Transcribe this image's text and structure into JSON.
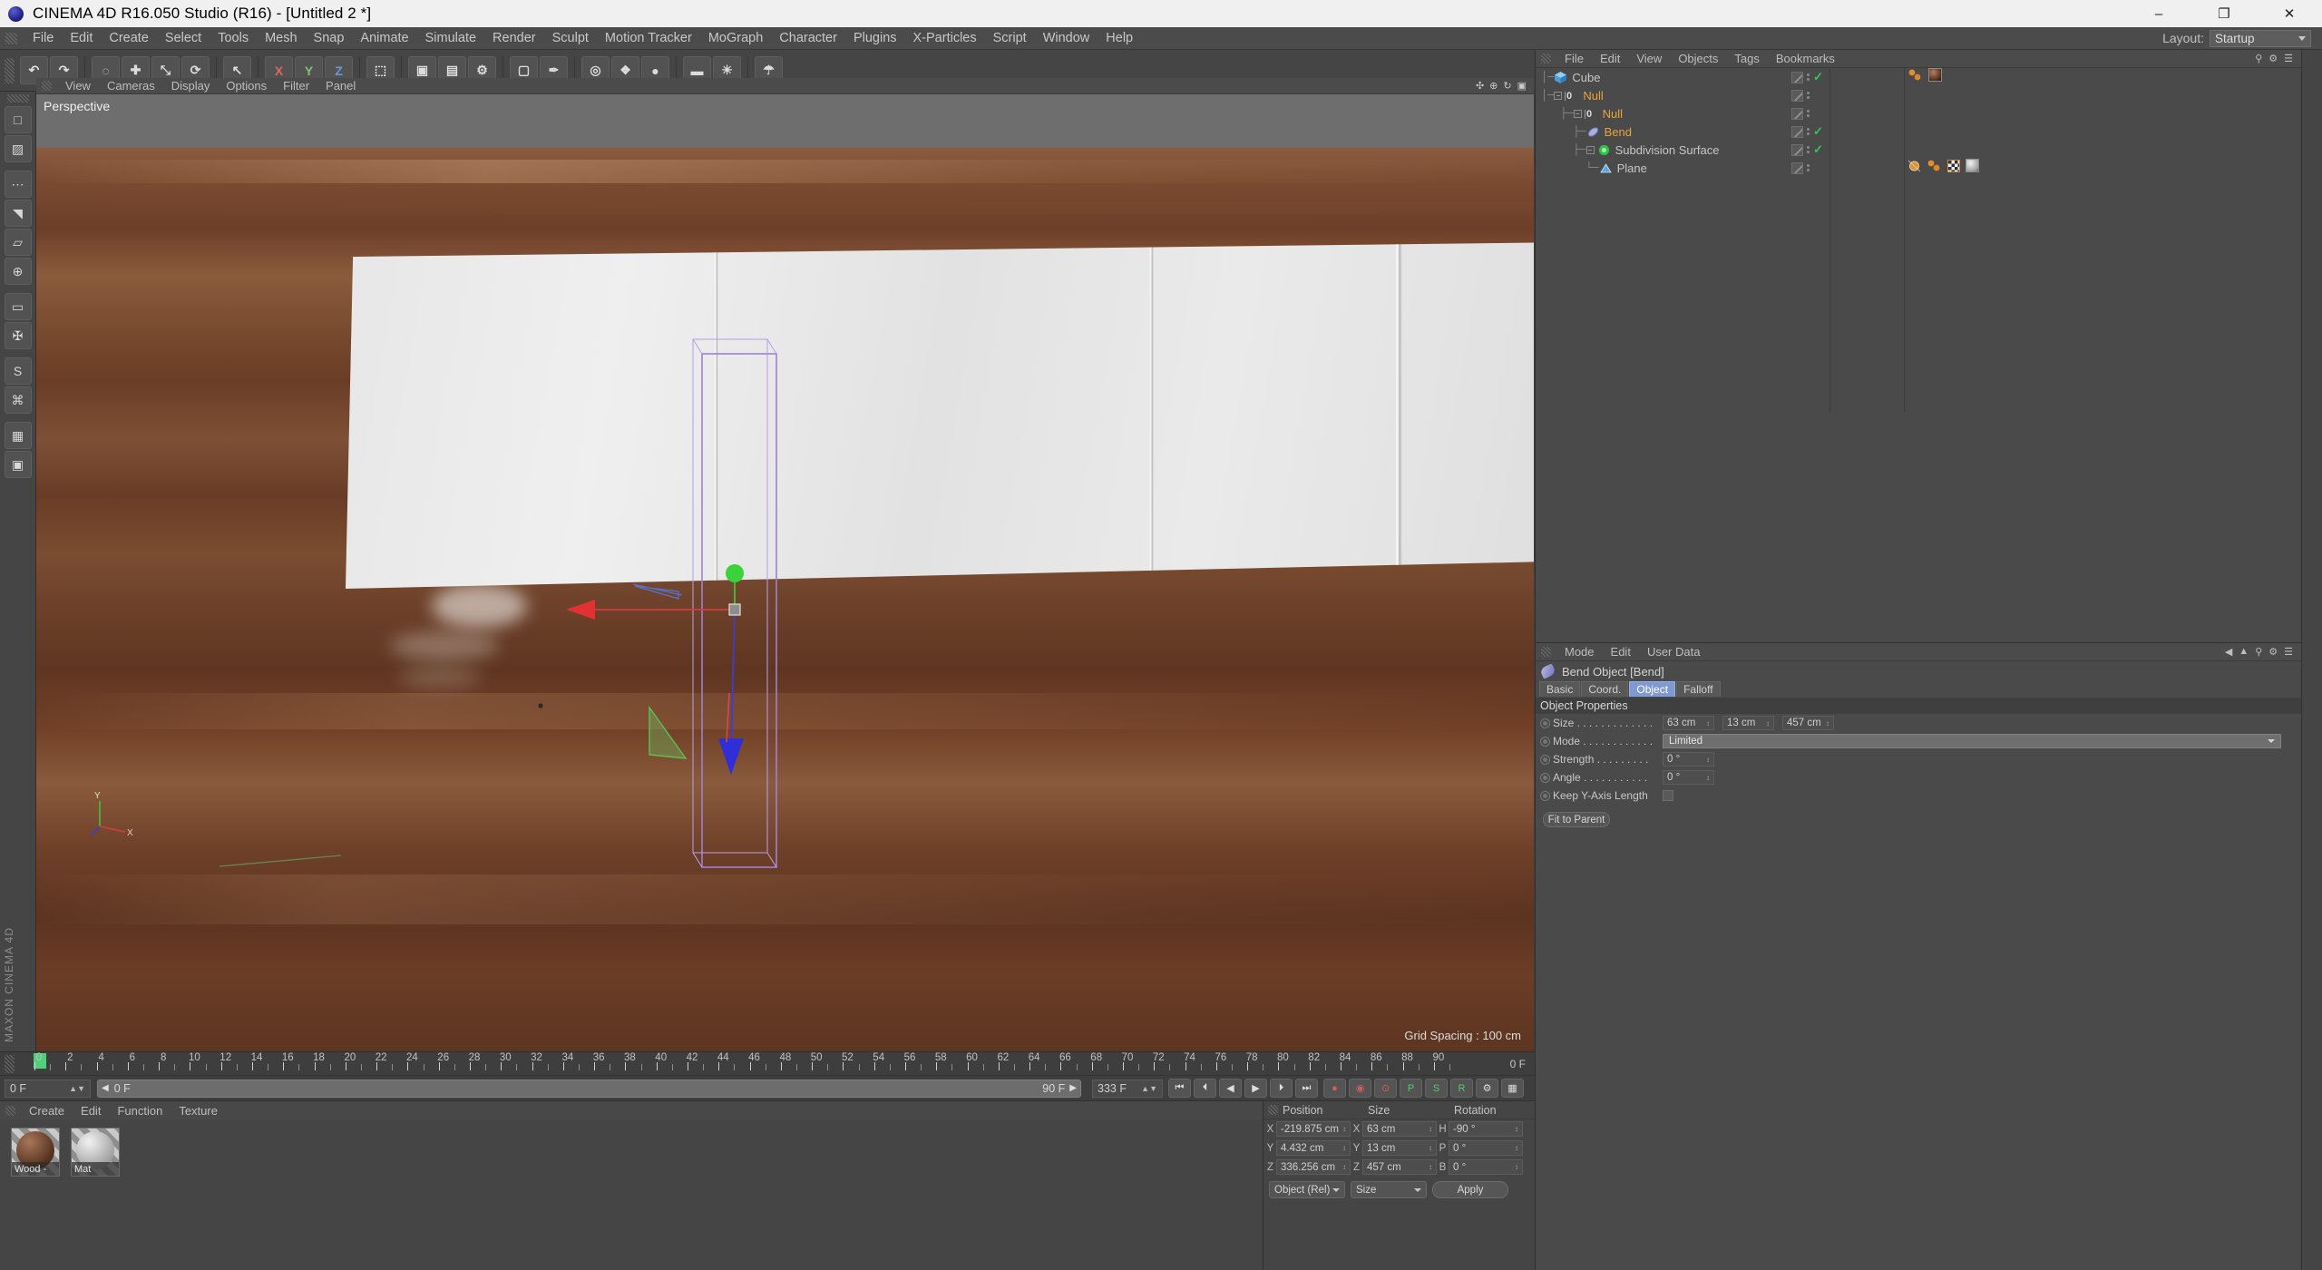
{
  "window": {
    "title": "CINEMA 4D R16.050 Studio (R16) - [Untitled 2 *]",
    "minimize": "–",
    "maximize": "❐",
    "close": "✕"
  },
  "menubar": {
    "items": [
      "File",
      "Edit",
      "Create",
      "Select",
      "Tools",
      "Mesh",
      "Snap",
      "Animate",
      "Simulate",
      "Render",
      "Sculpt",
      "Motion Tracker",
      "MoGraph",
      "Character",
      "Plugins",
      "X-Particles",
      "Script",
      "Window",
      "Help"
    ],
    "layout_label": "Layout:",
    "layout_value": "Startup"
  },
  "toolbar": {
    "groups": [
      [
        {
          "name": "undo-button",
          "glyph": "↶"
        },
        {
          "name": "redo-button",
          "glyph": "↷"
        }
      ],
      [
        {
          "name": "live-selection-tool",
          "glyph": "◌"
        },
        {
          "name": "move-tool",
          "glyph": "✚"
        },
        {
          "name": "scale-tool",
          "glyph": "⤡"
        },
        {
          "name": "rotate-tool",
          "glyph": "⟳"
        }
      ],
      [
        {
          "name": "cursor-tool",
          "glyph": "↖"
        }
      ],
      [
        {
          "name": "x-axis-lock",
          "glyph": "X",
          "cls": "x"
        },
        {
          "name": "y-axis-lock",
          "glyph": "Y",
          "cls": "y"
        },
        {
          "name": "z-axis-lock",
          "glyph": "Z",
          "cls": "z"
        }
      ],
      [
        {
          "name": "world-object-coords",
          "glyph": "⬚"
        }
      ],
      [
        {
          "name": "render-view-button",
          "glyph": "▣"
        },
        {
          "name": "render-region-button",
          "glyph": "▤"
        },
        {
          "name": "render-settings-button",
          "glyph": "⚙"
        }
      ],
      [
        {
          "name": "primitive-cube-button",
          "glyph": "▢"
        },
        {
          "name": "spline-pen-button",
          "glyph": "✒"
        }
      ],
      [
        {
          "name": "nurbs-button",
          "glyph": "◎"
        },
        {
          "name": "array-button",
          "glyph": "❖"
        },
        {
          "name": "scene-button",
          "glyph": "●"
        }
      ],
      [
        {
          "name": "camera-button",
          "glyph": "▬"
        },
        {
          "name": "light-button",
          "glyph": "☀"
        }
      ],
      [
        {
          "name": "deformer-button",
          "glyph": "☂"
        }
      ]
    ]
  },
  "left_palette": {
    "buttons": [
      {
        "name": "model-mode-button",
        "glyph": "□"
      },
      {
        "name": "texture-mode-button",
        "glyph": "▨"
      },
      {
        "name": "points-mode-button",
        "glyph": "⋯"
      },
      {
        "name": "edges-mode-button",
        "glyph": "◥"
      },
      {
        "name": "polygons-mode-button",
        "glyph": "▱"
      },
      {
        "name": "axis-mode-button",
        "glyph": "⊕"
      },
      {
        "name": "workplane-button",
        "glyph": "▭"
      },
      {
        "name": "enable-axis-button",
        "glyph": "✠"
      },
      {
        "name": "snap-toggle-button",
        "glyph": "S"
      },
      {
        "name": "magnet-tool-button",
        "glyph": "⌘"
      },
      {
        "name": "viewport-solo-button",
        "glyph": "▦"
      },
      {
        "name": "layout-grid-button",
        "glyph": "▣"
      }
    ],
    "brand": "MAXON CINEMA 4D"
  },
  "viewport": {
    "header_menu": [
      "View",
      "Cameras",
      "Display",
      "Options",
      "Filter",
      "Panel"
    ],
    "camera_label": "Perspective",
    "grid_spacing": "Grid Spacing : 100 cm",
    "axis_y_label": "Y",
    "axis_x_label": "X"
  },
  "timeline": {
    "ticks": [
      0,
      2,
      4,
      6,
      8,
      10,
      12,
      14,
      16,
      18,
      20,
      22,
      24,
      26,
      28,
      30,
      32,
      34,
      36,
      38,
      40,
      42,
      44,
      46,
      48,
      50,
      52,
      54,
      56,
      58,
      60,
      62,
      64,
      66,
      68,
      70,
      72,
      74,
      76,
      78,
      80,
      82,
      84,
      86,
      88,
      90
    ],
    "current_frame_right": "0 F",
    "frame_field": "0 F",
    "range_start": "0 F",
    "range_end": "90 F",
    "end_frame_field": "333 F",
    "transport": [
      {
        "name": "goto-start-button",
        "glyph": "⏮"
      },
      {
        "name": "step-back-button",
        "glyph": "⏴"
      },
      {
        "name": "play-back-button",
        "glyph": "◀"
      },
      {
        "name": "play-forward-button",
        "glyph": "▶"
      },
      {
        "name": "step-forward-button",
        "glyph": "⏵"
      },
      {
        "name": "goto-end-button",
        "glyph": "⏭"
      }
    ],
    "record_buttons": [
      {
        "name": "record-keyframe-button",
        "glyph": "●",
        "cls": "red"
      },
      {
        "name": "autokey-button",
        "glyph": "◉",
        "cls": "red"
      },
      {
        "name": "keyframe-selection-button",
        "glyph": "⊙",
        "cls": "red"
      },
      {
        "name": "position-key-button",
        "glyph": "P",
        "cls": "green"
      },
      {
        "name": "scale-key-button",
        "glyph": "S",
        "cls": "green"
      },
      {
        "name": "rotation-key-button",
        "glyph": "R",
        "cls": "green"
      },
      {
        "name": "param-key-button",
        "glyph": "⚙",
        "cls": ""
      },
      {
        "name": "pla-key-button",
        "glyph": "▦",
        "cls": ""
      }
    ]
  },
  "material_manager": {
    "menu": [
      "Create",
      "Edit",
      "Function",
      "Texture"
    ],
    "materials": [
      {
        "name": "Wood -",
        "color_top": "#a8765a",
        "color_bottom": "#4a2a17"
      },
      {
        "name": "Mat",
        "color_top": "#f2f2f2",
        "color_bottom": "#9a9a9a"
      }
    ]
  },
  "coordinate_manager": {
    "headers": [
      "Position",
      "Size",
      "Rotation"
    ],
    "rows": [
      {
        "pos_axis": "X",
        "pos_value": "-219.875 cm",
        "size_axis": "X",
        "size_value": "63 cm",
        "rot_axis": "H",
        "rot_value": "-90 °"
      },
      {
        "pos_axis": "Y",
        "pos_value": "4.432 cm",
        "size_axis": "Y",
        "size_value": "13 cm",
        "rot_axis": "P",
        "rot_value": "0 °"
      },
      {
        "pos_axis": "Z",
        "pos_value": "336.256 cm",
        "size_axis": "Z",
        "size_value": "457 cm",
        "rot_axis": "B",
        "rot_value": "0 °"
      }
    ],
    "mode_dropdown": "Object (Rel)",
    "size_dropdown": "Size",
    "apply_button": "Apply"
  },
  "object_manager": {
    "menu": [
      "File",
      "Edit",
      "View",
      "Objects",
      "Tags",
      "Bookmarks"
    ],
    "rows": [
      {
        "name": "Cube",
        "icon": "cube-icon",
        "indent": 0,
        "color": "grey",
        "expander": false,
        "visible_check": true,
        "materials": [
          "sphere-dots",
          "wood-thumb"
        ]
      },
      {
        "name": "Null",
        "icon": "null-icon",
        "indent": 0,
        "color": "orange",
        "expander": true,
        "visible_check": false,
        "materials": []
      },
      {
        "name": "Null",
        "icon": "null-icon",
        "indent": 1,
        "color": "orange",
        "expander": true,
        "visible_check": false,
        "materials": []
      },
      {
        "name": "Bend",
        "icon": "bend-icon",
        "indent": 2,
        "color": "orange",
        "expander": false,
        "visible_check": true,
        "materials": []
      },
      {
        "name": "Subdivision Surface",
        "icon": "subdivision-icon",
        "indent": 2,
        "color": "grey",
        "expander": true,
        "visible_check": true,
        "materials": []
      },
      {
        "name": "Plane",
        "icon": "plane-icon",
        "indent": 3,
        "color": "grey",
        "expander": false,
        "visible_check": false,
        "materials": [
          "phong-tag",
          "sphere-dots",
          "checker-tag",
          "mat-thumb"
        ]
      }
    ]
  },
  "attribute_manager": {
    "menu": [
      "Mode",
      "Edit",
      "User Data"
    ],
    "object_title": "Bend Object [Bend]",
    "tabs": [
      {
        "label": "Basic",
        "active": false
      },
      {
        "label": "Coord.",
        "active": false
      },
      {
        "label": "Object",
        "active": true
      },
      {
        "label": "Falloff",
        "active": false
      }
    ],
    "section_title": "Object Properties",
    "properties": [
      {
        "label": "Size . . . . . . . . . . . . .",
        "type": "triple",
        "values": [
          "63 cm",
          "13 cm",
          "457 cm"
        ]
      },
      {
        "label": "Mode . . . . . . . . . . . .",
        "type": "combo",
        "values": [
          "Limited"
        ]
      },
      {
        "label": "Strength . . . . . . . . .",
        "type": "single",
        "values": [
          "0 °"
        ]
      },
      {
        "label": "Angle . . . . . . . . . . .",
        "type": "single",
        "values": [
          "0 °"
        ]
      },
      {
        "label": "Keep Y-Axis Length",
        "type": "checkbox",
        "values": [
          ""
        ]
      }
    ],
    "fit_to_parent": "Fit to Parent"
  },
  "colors": {
    "accent_blue": "#7f9ad0",
    "orange_text": "#e8a33d",
    "green_check": "#37c45a",
    "panel_bg": "#4a4a4a",
    "toolbar_bg": "#454545",
    "axis_x": "#d63c3c",
    "axis_y": "#3cc43c",
    "axis_z": "#3c3cd6",
    "selection_violet": "#9f7fd6"
  }
}
